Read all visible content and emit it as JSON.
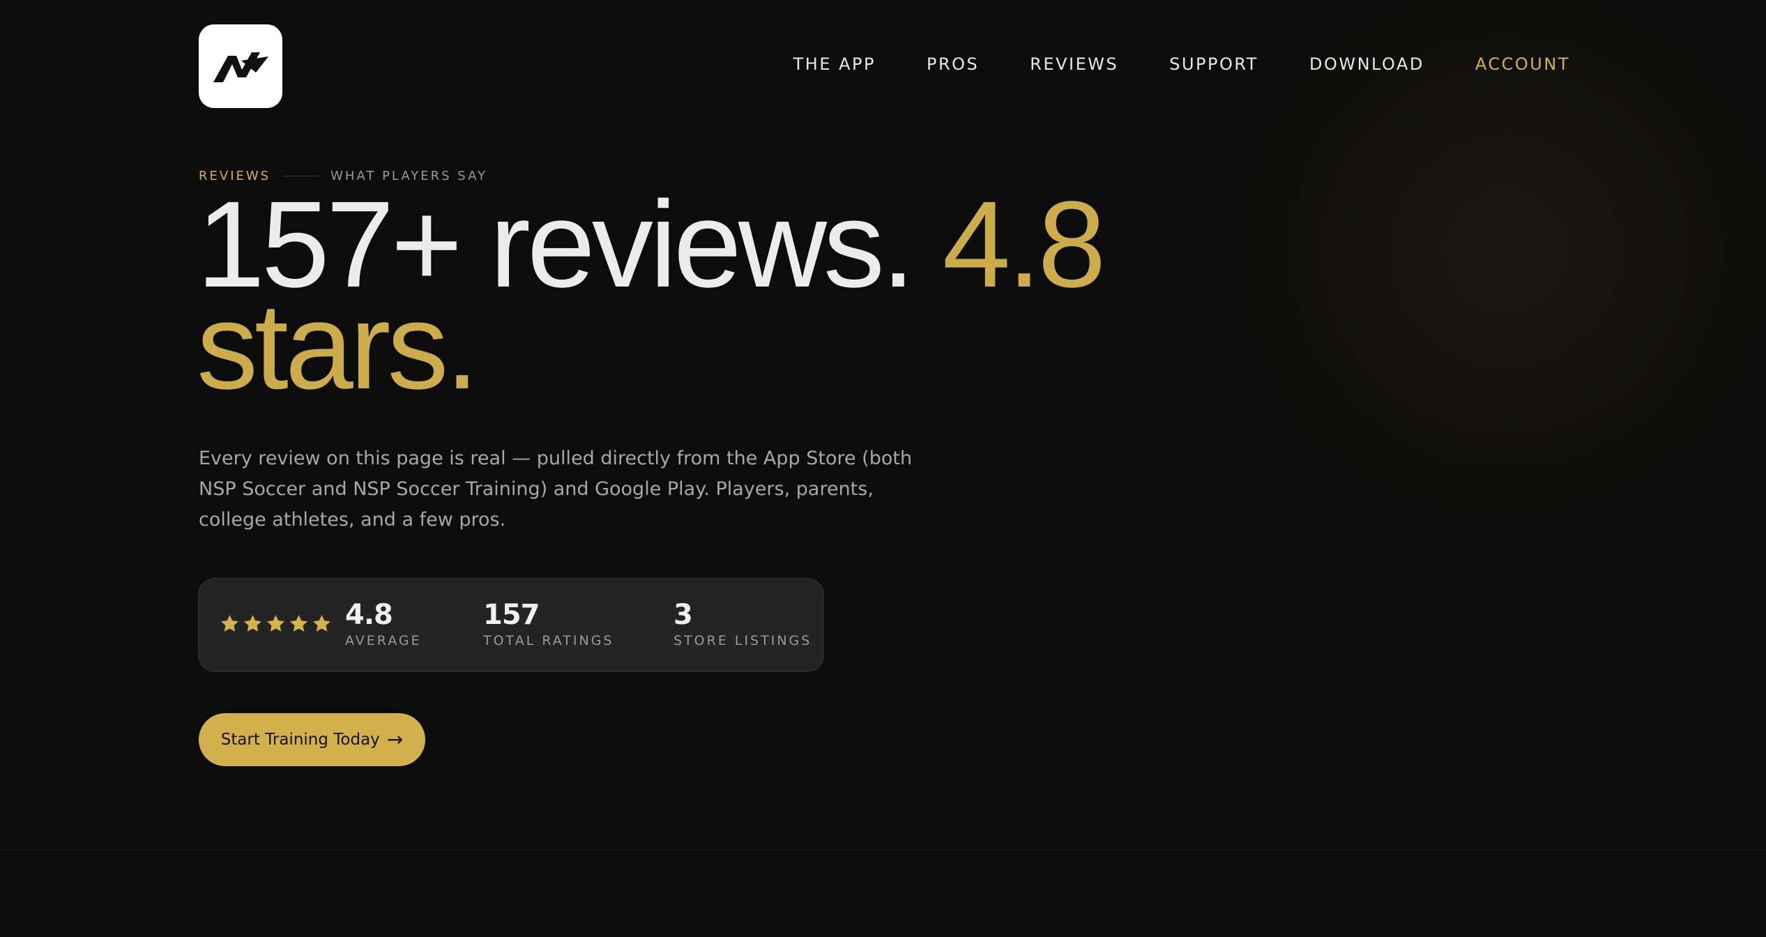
{
  "brand": {
    "logo_icon": "nsp-logo-icon"
  },
  "nav": {
    "items": [
      {
        "label": "THE APP"
      },
      {
        "label": "PROS"
      },
      {
        "label": "REVIEWS"
      },
      {
        "label": "SUPPORT"
      },
      {
        "label": "DOWNLOAD"
      },
      {
        "label": "ACCOUNT",
        "active": true
      }
    ]
  },
  "hero": {
    "eyebrow_tag": "REVIEWS",
    "eyebrow_sub": "WHAT PLAYERS SAY",
    "headline_white": "157+ reviews. ",
    "headline_gold": "4.8 stars.",
    "description": "Every review on this page is real — pulled directly from the App Store (both NSP Soccer and NSP Soccer Training) and Google Play. Players, parents, college athletes, and a few pros."
  },
  "stats": {
    "stars_filled": 5,
    "stars_total": 5,
    "average": {
      "value": "4.8",
      "label": "AVERAGE"
    },
    "total": {
      "value": "157",
      "label": "TOTAL RATINGS"
    },
    "listings": {
      "value": "3",
      "label": "STORE LISTINGS"
    }
  },
  "cta": {
    "label": "Start Training Today",
    "arrow": "→"
  },
  "colors": {
    "background": "#0c0c0c",
    "accent_gold": "#d4b24c",
    "text_primary": "#ececec",
    "text_muted": "#a7a7a7",
    "card_background": "#242424"
  }
}
